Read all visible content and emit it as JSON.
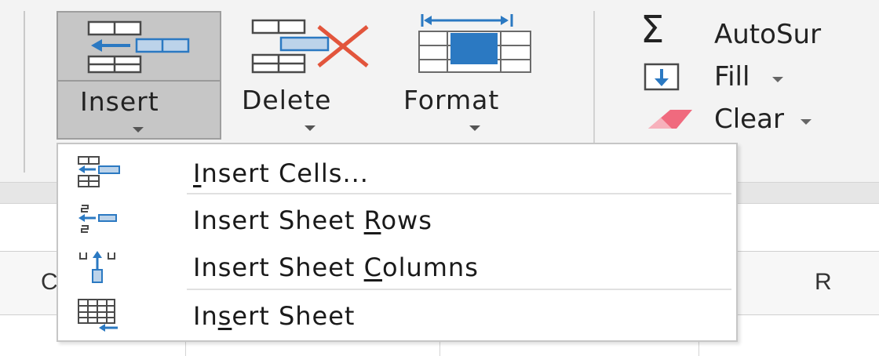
{
  "ribbon": {
    "insert_button": {
      "label": "Insert",
      "icon": "insert-cells-icon"
    },
    "delete_button": {
      "label": "Delete",
      "icon": "delete-cells-icon"
    },
    "format_button": {
      "label": "Format",
      "icon": "format-cells-icon"
    },
    "autosum": {
      "label": "AutoSur",
      "icon": "sigma-icon"
    },
    "fill": {
      "label": "Fill",
      "icon": "fill-down-icon"
    },
    "clear": {
      "label": "Clear",
      "icon": "eraser-icon"
    }
  },
  "column_headers": [
    "C",
    "R"
  ],
  "insert_menu": {
    "items": [
      {
        "pre": "",
        "accel": "I",
        "post": "nsert Cells...",
        "icon": "insert-cells-icon"
      },
      {
        "pre": "Insert Sheet ",
        "accel": "R",
        "post": "ows",
        "icon": "insert-rows-icon"
      },
      {
        "pre": "Insert Sheet ",
        "accel": "C",
        "post": "olumns",
        "icon": "insert-columns-icon"
      },
      {
        "pre": "In",
        "accel": "s",
        "post": "ert Sheet",
        "icon": "insert-sheet-icon"
      }
    ]
  },
  "colors": {
    "ribbon_bg": "#f3f3f3",
    "pressed_button_bg": "#c6c6c6",
    "accent_blue": "#2b79c2",
    "delete_red": "#e2553c"
  }
}
